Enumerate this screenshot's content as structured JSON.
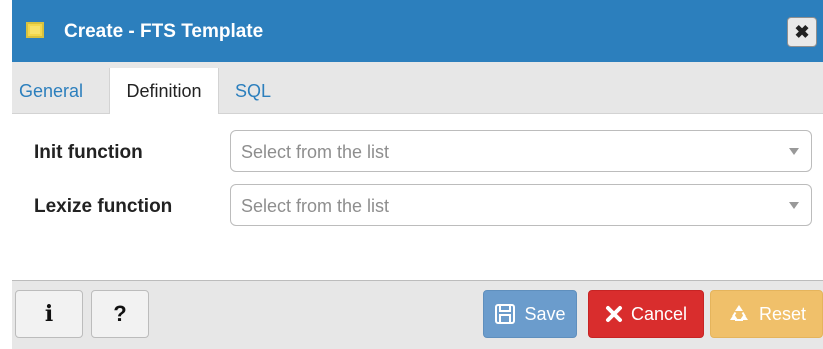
{
  "dialog": {
    "title": "Create - FTS Template",
    "close_glyph": "✖"
  },
  "tabs": [
    {
      "label": "General"
    },
    {
      "label": "Definition"
    },
    {
      "label": "SQL"
    }
  ],
  "fields": {
    "init": {
      "label": "Init function",
      "placeholder": "Select from the list"
    },
    "lexize": {
      "label": "Lexize function",
      "placeholder": "Select from the list"
    }
  },
  "footer": {
    "info_label": "i",
    "help_label": "?",
    "save_label": "Save",
    "cancel_label": "Cancel",
    "reset_label": "Reset"
  },
  "colors": {
    "titlebar": "#2c7fbd",
    "save": "#6b9ccc",
    "cancel": "#d92d2d",
    "reset": "#f0c06a"
  },
  "icons": {
    "title": "folder-icon",
    "close": "close-icon",
    "save": "save-icon",
    "cancel": "cancel-icon",
    "reset": "recycle-icon",
    "dropdown": "chevron-down-icon"
  }
}
